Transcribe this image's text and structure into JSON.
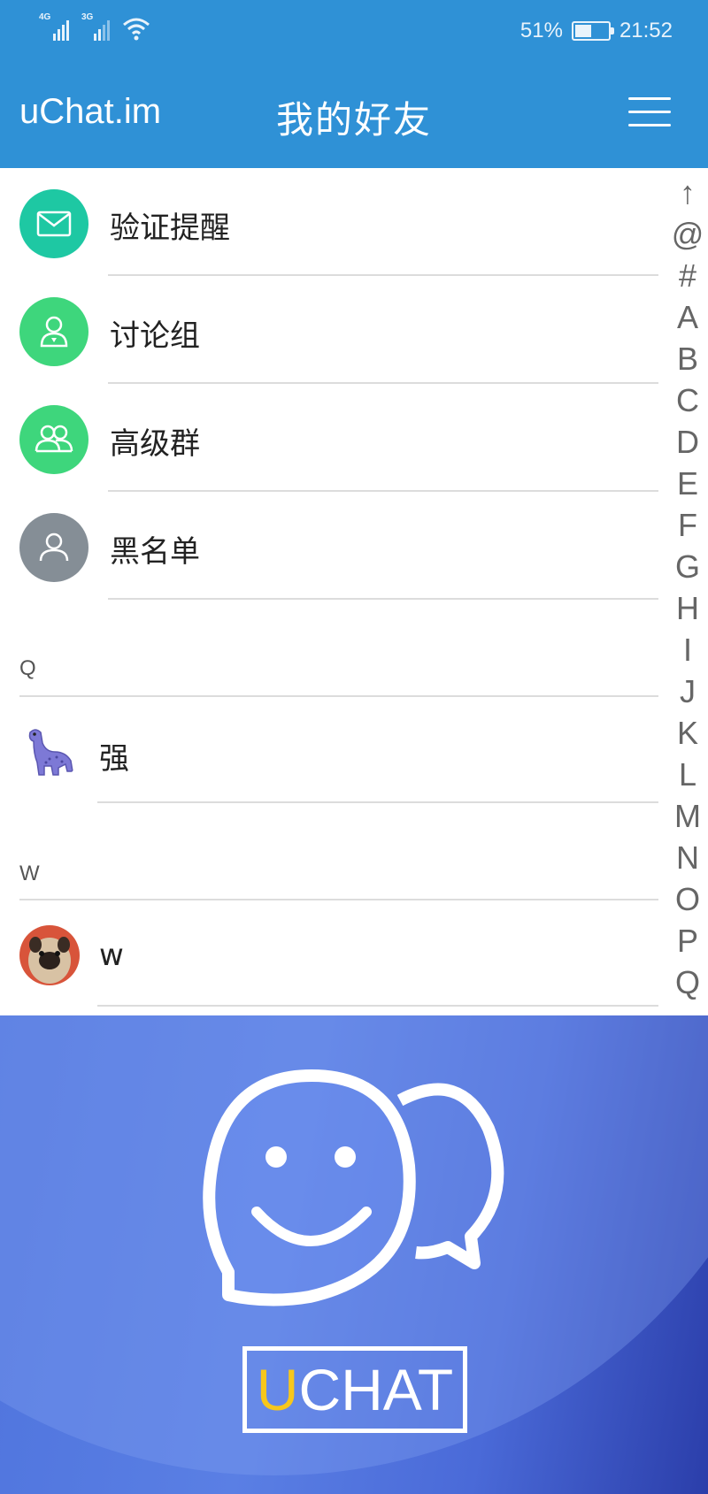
{
  "status_bar": {
    "signal_1_label": "4G",
    "signal_2_label": "3G",
    "battery": "51%",
    "battery_level": 0.51,
    "time": "21:52"
  },
  "header": {
    "app_name": "uChat.im",
    "title": "我的好友",
    "menu_icon": "hamburger-menu-icon"
  },
  "system_items": [
    {
      "label": "验证提醒",
      "icon": "envelope-icon",
      "color": "#1ec8a3"
    },
    {
      "label": "讨论组",
      "icon": "person-badge-icon",
      "color": "#3ed67c"
    },
    {
      "label": "高级群",
      "icon": "group-icon",
      "color": "#3ed67c"
    },
    {
      "label": "黑名单",
      "icon": "person-icon",
      "color": "#858e96"
    }
  ],
  "sections": [
    {
      "letter": "Q",
      "contacts": [
        {
          "name": "强",
          "avatar": "dinosaur-avatar"
        }
      ]
    },
    {
      "letter": "W",
      "contacts": [
        {
          "name": "w",
          "avatar": "pug-avatar"
        }
      ]
    }
  ],
  "alphabet_index": [
    "↑",
    "@",
    "#",
    "A",
    "B",
    "C",
    "D",
    "E",
    "F",
    "G",
    "H",
    "I",
    "J",
    "K",
    "L",
    "M",
    "N",
    "O",
    "P",
    "Q"
  ],
  "banner": {
    "logo_first_letter": "U",
    "logo_rest": "CHAT",
    "accent_color": "#f7c71b"
  },
  "colors": {
    "primary": "#2f91d6"
  }
}
